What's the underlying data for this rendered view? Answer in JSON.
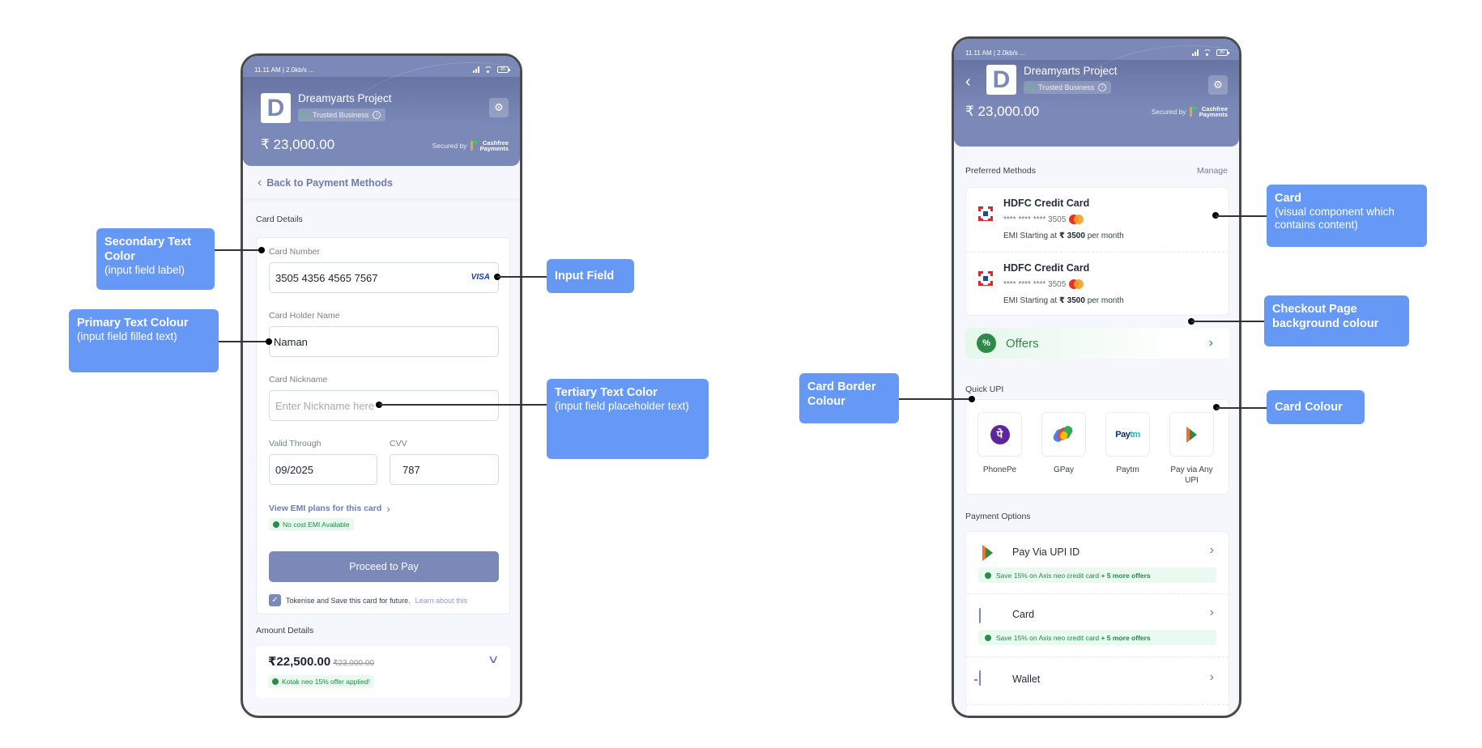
{
  "colors": {
    "header_bg": "#7b89b8",
    "page_bg": "#f5f7fc",
    "card_bg": "#ffffff",
    "card_border": "#eceff6",
    "accent_text": "#6f7cb0",
    "success_green": "#2f8a4a",
    "annotation_bg": "#6698f5"
  },
  "status_bar": {
    "left_text": "11.11 AM | 2.0kb/s ...",
    "battery": "80"
  },
  "merchant": {
    "logo_letter": "D",
    "name": "Dreamyarts Project",
    "badge": "Trusted Business",
    "amount": "₹ 23,000.00",
    "secured_by": "Secured by",
    "provider_line1": "Cashfree",
    "provider_line2": "Payments"
  },
  "left_screen": {
    "back_label": "Back to Payment Methods",
    "card_details_title": "Card Details",
    "fields": {
      "card_number": {
        "label": "Card Number",
        "value": "3505 4356 4565 7567",
        "brand": "VISA"
      },
      "holder_name": {
        "label": "Card Holder Name",
        "value": "Naman"
      },
      "nickname": {
        "label": "Card Nickname",
        "placeholder": "Enter Nickname here"
      },
      "valid_through": {
        "label": "Valid Through",
        "value": "09/2025"
      },
      "cvv": {
        "label": "CVV",
        "value": "787"
      }
    },
    "emi_link": "View EMI plans for this card",
    "emi_badge": "No cost EMI Available",
    "proceed_button": "Proceed to Pay",
    "tokenise_checked": true,
    "tokenise_text": "Tokenise and Save this card for future.",
    "learn_link": "Learn about this",
    "amount_details_title": "Amount Details",
    "discounted_amount": "₹22,500.00",
    "original_amount": "₹23,000.00",
    "offer_applied": "Kotak neo 15% offer applied!"
  },
  "right_screen": {
    "preferred_title": "Preferred Methods",
    "manage_label": "Manage",
    "saved_cards": [
      {
        "bank": "HDFC Credit Card",
        "masked": "**** **** **** 3505",
        "emi_prefix": "EMI Starting at",
        "emi_amount": "₹ 3500",
        "emi_suffix": "per month"
      },
      {
        "bank": "HDFC Credit Card",
        "masked": "**** **** **** 3505",
        "emi_prefix": "EMI Starting at",
        "emi_amount": "₹ 3500",
        "emi_suffix": "per month"
      }
    ],
    "offers_label": "Offers",
    "quick_upi_title": "Quick UPI",
    "upi_apps": [
      {
        "name": "PhonePe",
        "icon": "phonepe-icon"
      },
      {
        "name": "GPay",
        "icon": "gpay-icon"
      },
      {
        "name": "Paytm",
        "icon": "paytm-icon"
      },
      {
        "name": "Pay via Any UPI",
        "icon": "bhim-upi-icon"
      }
    ],
    "payment_options_title": "Payment Options",
    "payment_options": [
      {
        "label": "Pay Via UPI ID",
        "icon": "upi-icon",
        "offer": "Save 15% on Axis neo credit card",
        "offer_more": "+ 5 more offers"
      },
      {
        "label": "Card",
        "icon": "card-icon",
        "offer": "Save 15% on Axis neo credit card",
        "offer_more": "+ 5 more offers"
      },
      {
        "label": "Wallet",
        "icon": "wallet-icon"
      }
    ]
  },
  "annotations": {
    "secondary_text": {
      "title": "Secondary Text Color",
      "note": "(input field label)"
    },
    "primary_text": {
      "title": "Primary Text Colour",
      "note": "(input field filled text)"
    },
    "input_field": {
      "title": "Input Field"
    },
    "tertiary_text": {
      "title": "Tertiary Text Color",
      "note": "(input field placeholder text)"
    },
    "card": {
      "title": "Card",
      "note": "(visual component which contains content)"
    },
    "checkout_bg": {
      "title": "Checkout Page background colour"
    },
    "card_colour": {
      "title": "Card Colour"
    },
    "card_border": {
      "title": "Card Border Colour"
    }
  }
}
